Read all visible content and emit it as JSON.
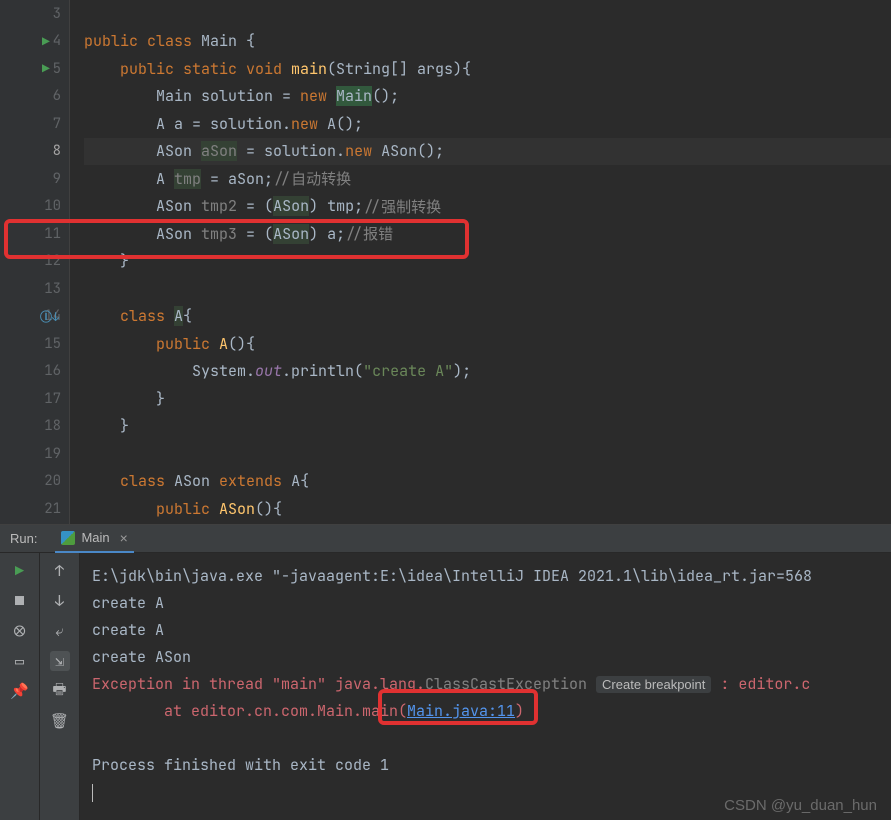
{
  "editor": {
    "lines": [
      {
        "n": 3,
        "run": false,
        "content": []
      },
      {
        "n": 4,
        "run": true,
        "content": [
          {
            "t": "kw",
            "s": "public class "
          },
          {
            "t": "type",
            "s": "Main {"
          }
        ]
      },
      {
        "n": 5,
        "run": true,
        "indent": 1,
        "content": [
          {
            "t": "kw",
            "s": "public static void "
          },
          {
            "t": "method",
            "s": "main"
          },
          {
            "t": "paren",
            "s": "(String[] args){"
          }
        ]
      },
      {
        "n": 6,
        "indent": 2,
        "content": [
          {
            "t": "type",
            "s": "Main solution = "
          },
          {
            "t": "kw",
            "s": "new "
          },
          {
            "t": "type",
            "s": ""
          },
          {
            "t": "highlight-box",
            "s": "Main"
          },
          {
            "t": "type",
            "s": "();"
          }
        ]
      },
      {
        "n": 7,
        "indent": 2,
        "content": [
          {
            "t": "type",
            "s": "A a = solution."
          },
          {
            "t": "kw",
            "s": "new "
          },
          {
            "t": "type",
            "s": "A();"
          }
        ]
      },
      {
        "n": 8,
        "active": true,
        "indent": 2,
        "hl": true,
        "content": [
          {
            "t": "type",
            "s": "ASon "
          },
          {
            "t": "unused hl",
            "s": "aSon"
          },
          {
            "t": "type",
            "s": " = solution."
          },
          {
            "t": "kw",
            "s": "new "
          },
          {
            "t": "type",
            "s": "ASon();"
          }
        ]
      },
      {
        "n": 9,
        "indent": 2,
        "content": [
          {
            "t": "type",
            "s": "A "
          },
          {
            "t": "unused hl",
            "s": "tmp"
          },
          {
            "t": "type",
            "s": " = aSon;"
          },
          {
            "t": "comment",
            "s": "//自动转换"
          }
        ]
      },
      {
        "n": 10,
        "indent": 2,
        "content": [
          {
            "t": "type",
            "s": "ASon "
          },
          {
            "t": "unused",
            "s": "tmp2"
          },
          {
            "t": "type",
            "s": " = ("
          },
          {
            "t": "type hl",
            "s": "ASon"
          },
          {
            "t": "type",
            "s": ") tmp;"
          },
          {
            "t": "comment",
            "s": "//强制转换"
          }
        ]
      },
      {
        "n": 11,
        "indent": 2,
        "redbox": true,
        "content": [
          {
            "t": "type",
            "s": "ASon "
          },
          {
            "t": "unused",
            "s": "tmp3"
          },
          {
            "t": "type",
            "s": " = ("
          },
          {
            "t": "type hl",
            "s": "ASon"
          },
          {
            "t": "type",
            "s": ") a;"
          },
          {
            "t": "comment",
            "s": "//报错"
          }
        ]
      },
      {
        "n": 12,
        "indent": 1,
        "content": [
          {
            "t": "type",
            "s": "}"
          }
        ]
      },
      {
        "n": 13,
        "content": []
      },
      {
        "n": 14,
        "impl": true,
        "indent": 1,
        "content": [
          {
            "t": "kw",
            "s": "class "
          },
          {
            "t": "type hl",
            "s": "A"
          },
          {
            "t": "type",
            "s": "{"
          }
        ]
      },
      {
        "n": 15,
        "indent": 2,
        "content": [
          {
            "t": "kw",
            "s": "public "
          },
          {
            "t": "method",
            "s": "A"
          },
          {
            "t": "type",
            "s": "(){"
          }
        ]
      },
      {
        "n": 16,
        "indent": 3,
        "content": [
          {
            "t": "type",
            "s": "System."
          },
          {
            "t": "field-italic",
            "s": "out"
          },
          {
            "t": "type",
            "s": ".println("
          },
          {
            "t": "str",
            "s": "\"create A\""
          },
          {
            "t": "type",
            "s": ");"
          }
        ]
      },
      {
        "n": 17,
        "indent": 2,
        "content": [
          {
            "t": "type",
            "s": "}"
          }
        ]
      },
      {
        "n": 18,
        "indent": 1,
        "content": [
          {
            "t": "type",
            "s": "}"
          }
        ]
      },
      {
        "n": 19,
        "content": []
      },
      {
        "n": 20,
        "indent": 1,
        "content": [
          {
            "t": "kw",
            "s": "class "
          },
          {
            "t": "type",
            "s": "ASon "
          },
          {
            "t": "kw",
            "s": "extends "
          },
          {
            "t": "type",
            "s": "A{"
          }
        ]
      },
      {
        "n": 21,
        "indent": 2,
        "content": [
          {
            "t": "kw",
            "s": "public "
          },
          {
            "t": "method",
            "s": "ASon"
          },
          {
            "t": "type",
            "s": "(){"
          }
        ]
      }
    ]
  },
  "run": {
    "label": "Run:",
    "tab": "Main",
    "console": {
      "cmd": "E:\\jdk\\bin\\java.exe \"-javaagent:E:\\idea\\IntelliJ IDEA 2021.1\\lib\\idea_rt.jar=568",
      "out1": "create A",
      "out2": "create A",
      "out3": "create ASon",
      "err_prefix": "Exception in thread \"main\" java.lang.",
      "err_ex": "ClassCastException",
      "breakpoint": "Create breakpoint",
      "err_suffix": ": editor.c",
      "at_prefix": "\tat editor.cn.com.Main.main(",
      "at_link": "Main.java:11",
      "at_suffix": ")",
      "exit": "Process finished with exit code 1"
    }
  },
  "watermark": "CSDN @yu_duan_hun"
}
